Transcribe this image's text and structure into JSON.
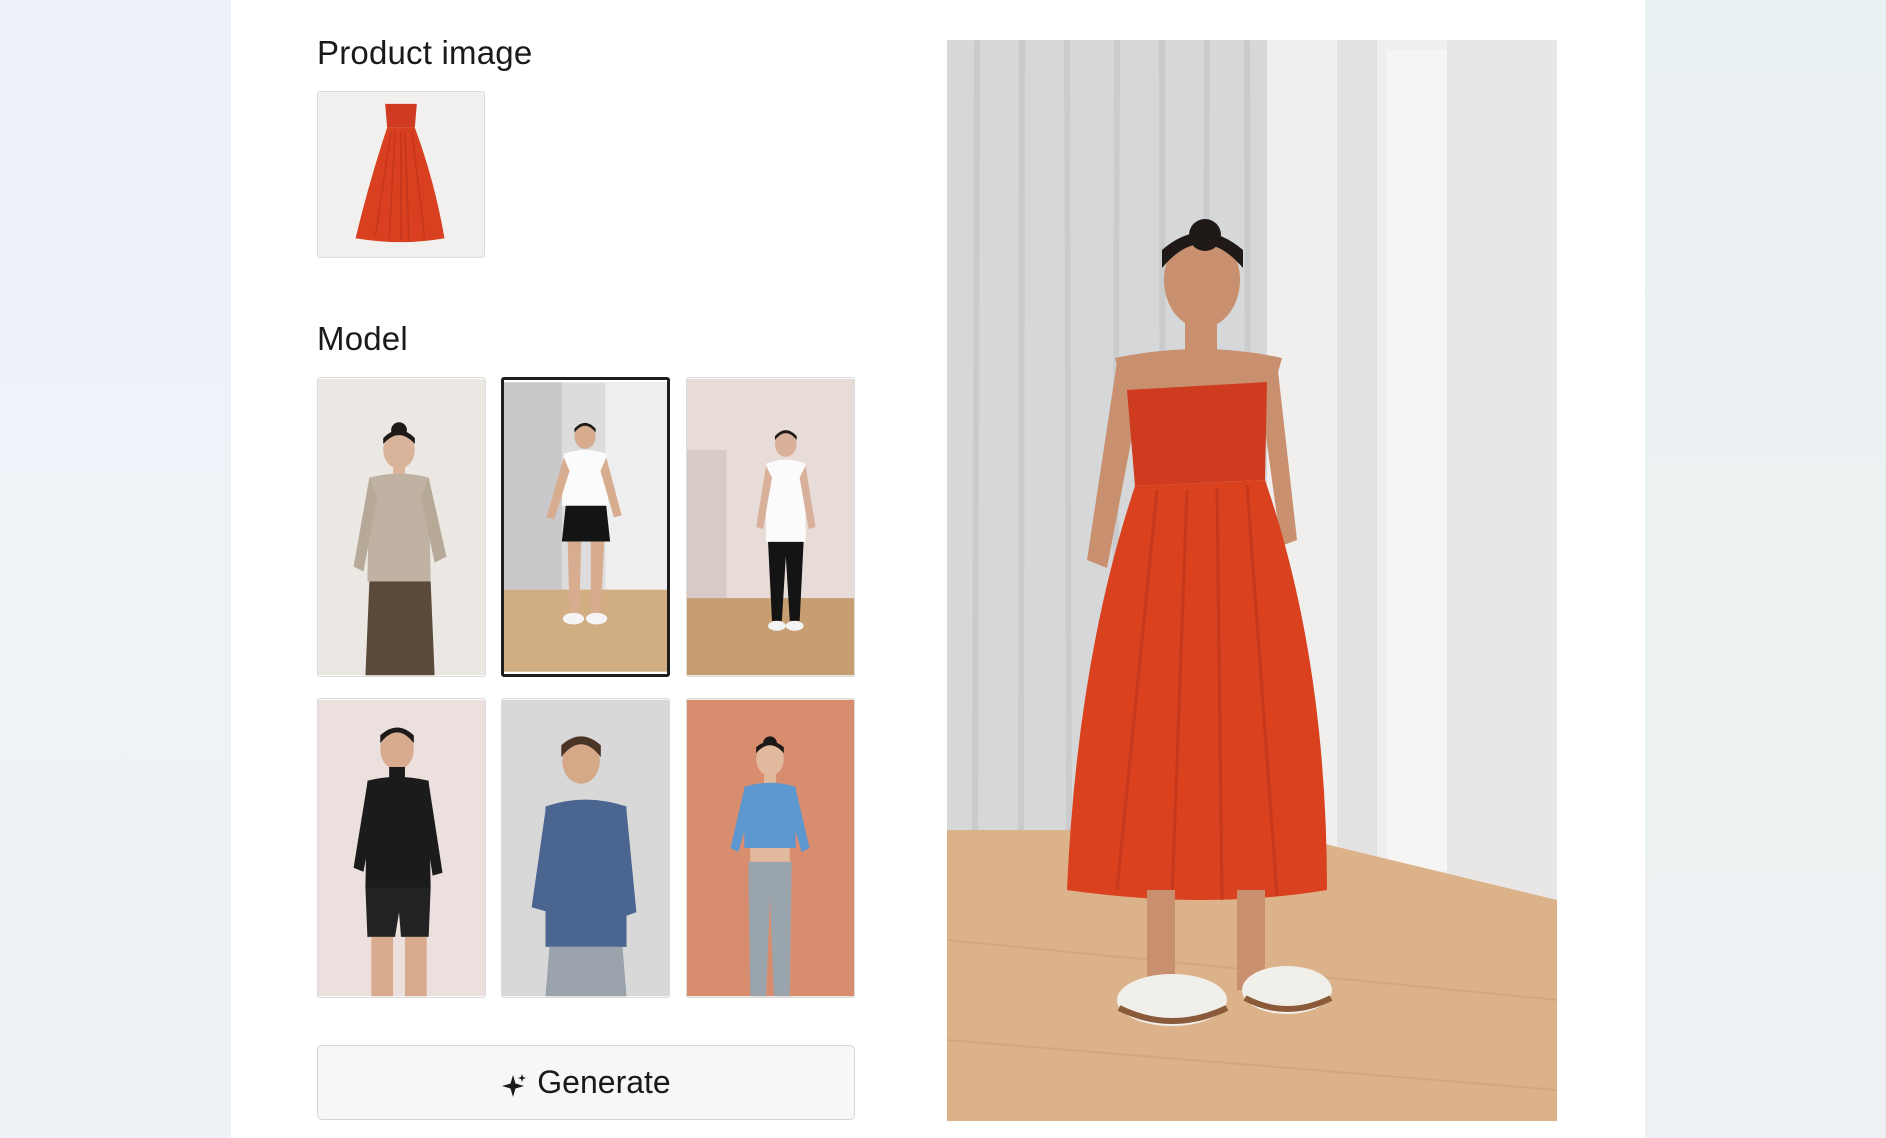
{
  "sections": {
    "product_image_title": "Product image",
    "model_title": "Model"
  },
  "product": {
    "thumbnail": "red-strapless-dress",
    "color": "#d83a22"
  },
  "models": [
    {
      "id": "model-1",
      "outfit": "beige cardigan, brown leather skirt",
      "selected": false
    },
    {
      "id": "model-2",
      "outfit": "white tee, black shorts",
      "selected": true
    },
    {
      "id": "model-3",
      "outfit": "white tee, black pants",
      "selected": false
    },
    {
      "id": "model-4",
      "outfit": "black turtleneck, black shorts",
      "selected": false
    },
    {
      "id": "model-5",
      "outfit": "blue long-sleeve, jeans",
      "selected": false
    },
    {
      "id": "model-6",
      "outfit": "blue crop top, jeans",
      "selected": false
    }
  ],
  "generate_button": {
    "label": "Generate",
    "icon": "sparkle-icon"
  },
  "result": {
    "description": "model wearing red strapless dress",
    "dress_color": "#d83a22"
  },
  "colors": {
    "selected_border": "#1e1e1e",
    "panel_bg": "#ffffff"
  }
}
